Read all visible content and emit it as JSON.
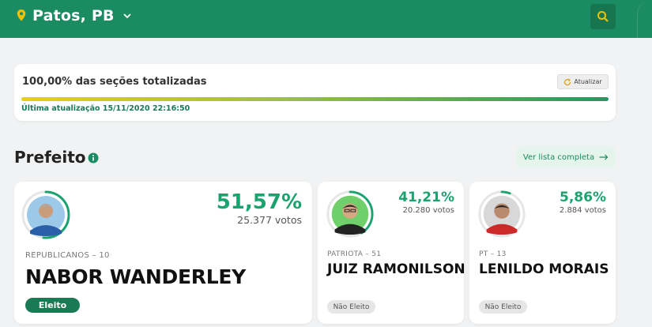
{
  "header": {
    "location": "Patos, PB",
    "icons": {
      "location": "map-pin-icon",
      "dropdown": "chevron-down-icon",
      "search": "search-icon"
    },
    "colors": {
      "background": "#1a8b62",
      "pin": "#f2c200"
    }
  },
  "status": {
    "sections_text": "100,00% das seções totalizadas",
    "refresh_label": "Atualizar",
    "progress_fraction": 1.0,
    "last_update": "Última atualização 15/11/2020 22:16:50"
  },
  "section": {
    "title": "Prefeito",
    "full_list_label": "Ver lista completa"
  },
  "candidates": [
    {
      "party": "REPUBLICANOS – 10",
      "name": "NABOR WANDERLEY",
      "percent": "51,57%",
      "votes": "25.377 votos",
      "status": "Eleito",
      "share": 0.5157,
      "shirt": "#2a5fa8"
    },
    {
      "party": "PATRIOTA – 51",
      "name": "JUIZ RAMONILSON",
      "percent": "41,21%",
      "votes": "20.280 votos",
      "status": "Não Eleito",
      "share": 0.4121,
      "shirt": "#222222"
    },
    {
      "party": "PT – 13",
      "name": "LENILDO MORAIS",
      "percent": "5,86%",
      "votes": "2.884 votos",
      "status": "Não Eleito",
      "share": 0.0586,
      "shirt": "#cc2a2a"
    }
  ]
}
